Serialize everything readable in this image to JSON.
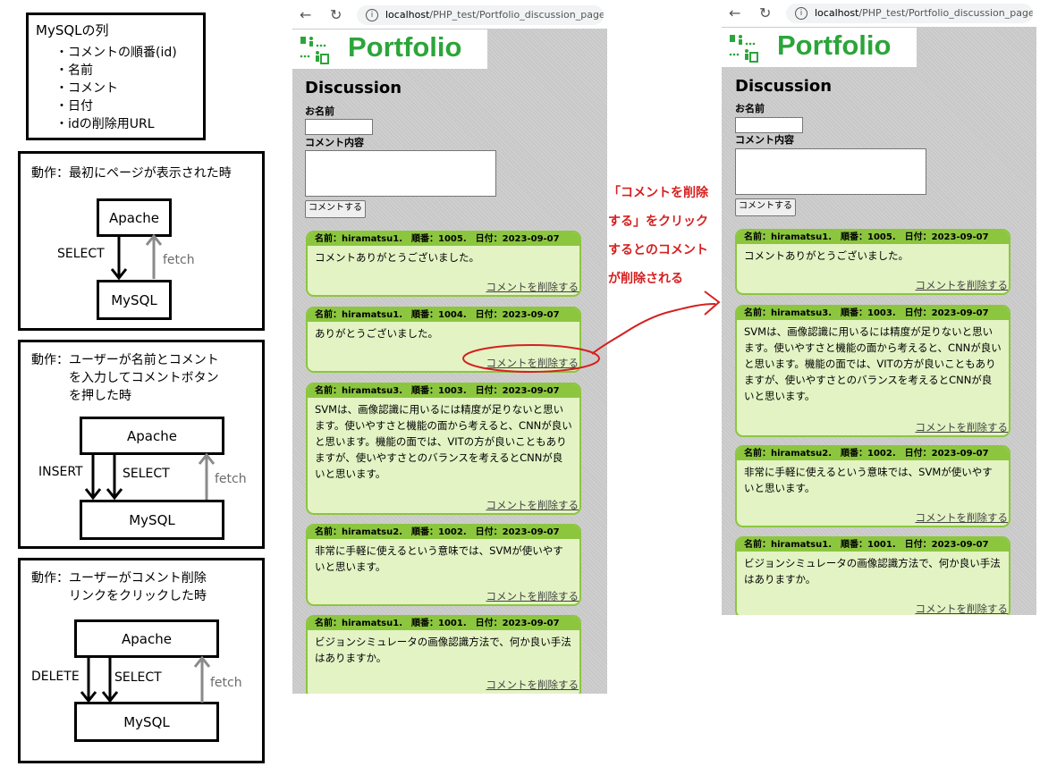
{
  "mysql_columns": {
    "title": "MySQLの列",
    "items": [
      "・コメントの順番(id)",
      "・名前",
      "・コメント",
      "・日付",
      "・idの削除用URL"
    ]
  },
  "diagram1": {
    "action": "動作：最初にページが表示された時",
    "apache": "Apache",
    "mysql": "MySQL",
    "select": "SELECT",
    "fetch": "fetch"
  },
  "diagram2": {
    "action": "動作：ユーザーが名前とコメント\n　　　を入力してコメントボタン\n　　　を押した時",
    "apache": "Apache",
    "mysql": "MySQL",
    "insert": "INSERT",
    "select": "SELECT",
    "fetch": "fetch"
  },
  "diagram3": {
    "action": "動作：ユーザーがコメント削除\n　　　リンクをクリックした時",
    "apache": "Apache",
    "mysql": "MySQL",
    "delete": "DELETE",
    "select": "SELECT",
    "fetch": "fetch"
  },
  "browser": {
    "url_host": "localhost",
    "url_path": "/PHP_test/Portfolio_discussion_page.php",
    "logo": "Portfolio",
    "discussion_title": "Discussion",
    "name_label": "お名前",
    "comment_label": "コメント内容",
    "submit_label": "コメントする",
    "delete_label": "コメントを削除する"
  },
  "before_comments": [
    {
      "header": "名前：hiramatsu1.　順番：1005.　日付：2023-09-07",
      "text": "コメントありがとうございました。"
    },
    {
      "header": "名前：hiramatsu1.　順番：1004.　日付：2023-09-07",
      "text": "ありがとうございました。"
    },
    {
      "header": "名前：hiramatsu3.　順番：1003.　日付：2023-09-07",
      "text": "SVMは、画像認識に用いるには精度が足りないと思います。使いやすさと機能の面から考えると、CNNが良いと思います。機能の面では、VITの方が良いこともありますが、使いやすさとのバランスを考えるとCNNが良いと思います。"
    },
    {
      "header": "名前：hiramatsu2.　順番：1002.　日付：2023-09-07",
      "text": "非常に手軽に使えるという意味では、SVMが使いやすいと思います。"
    },
    {
      "header": "名前：hiramatsu1.　順番：1001.　日付：2023-09-07",
      "text": "ビジョンシミュレータの画像認識方法で、何か良い手法はありますか。"
    }
  ],
  "after_comments": [
    {
      "header": "名前：hiramatsu1.　順番：1005.　日付：2023-09-07",
      "text": "コメントありがとうございました。"
    },
    {
      "header": "名前：hiramatsu3.　順番：1003.　日付：2023-09-07",
      "text": "SVMは、画像認識に用いるには精度が足りないと思います。使いやすさと機能の面から考えると、CNNが良いと思います。機能の面では、VITの方が良いこともありますが、使いやすさとのバランスを考えるとCNNが良いと思います。"
    },
    {
      "header": "名前：hiramatsu2.　順番：1002.　日付：2023-09-07",
      "text": "非常に手軽に使えるという意味では、SVMが使いやすいと思います。"
    },
    {
      "header": "名前：hiramatsu1.　順番：1001.　日付：2023-09-07",
      "text": "ビジョンシミュレータの画像認識方法で、何か良い手法はありますか。"
    }
  ],
  "annotation": "「コメントを削除\nする」をクリック\nするとのコメント\nが削除される",
  "colors": {
    "accent_green": "#2ba53a",
    "card_border": "#8cc63f",
    "card_bg": "#e3f3c4",
    "annotation_red": "#d62020"
  }
}
